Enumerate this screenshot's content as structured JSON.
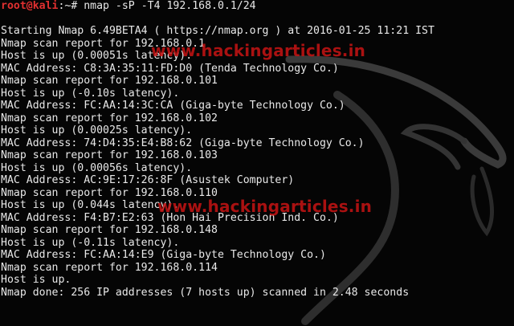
{
  "prompt": {
    "user_host": "root@kali",
    "sep": ":~# ",
    "command": "nmap -sP -T4 192.168.0.1/24"
  },
  "output": [
    "",
    "Starting Nmap 6.49BETA4 ( https://nmap.org ) at 2016-01-25 11:21 IST",
    "Nmap scan report for 192.168.0.1",
    "Host is up (0.00051s latency).",
    "MAC Address: C8:3A:35:11:FD:D0 (Tenda Technology Co.)",
    "Nmap scan report for 192.168.0.101",
    "Host is up (-0.10s latency).",
    "MAC Address: FC:AA:14:3C:CA (Giga-byte Technology Co.)",
    "Nmap scan report for 192.168.0.102",
    "Host is up (0.00025s latency).",
    "MAC Address: 74:D4:35:E4:B8:62 (Giga-byte Technology Co.)",
    "Nmap scan report for 192.168.0.103",
    "Host is up (0.00056s latency).",
    "MAC Address: AC:9E:17:26:8F (Asustek Computer)",
    "Nmap scan report for 192.168.0.110",
    "Host is up (0.044s latency).",
    "MAC Address: F4:B7:E2:63 (Hon Hai Precision Ind. Co.)",
    "Nmap scan report for 192.168.0.148",
    "Host is up (-0.11s latency).",
    "MAC Address: FC:AA:14:E9 (Giga-byte Technology Co.)",
    "Nmap scan report for 192.168.0.114",
    "Host is up.",
    "Nmap done: 256 IP addresses (7 hosts up) scanned in 2.48 seconds"
  ],
  "watermarks": {
    "top": "www.hackingarticles.in",
    "bottom": "www.hackingarticles.in"
  },
  "colors": {
    "background": "#050505",
    "text": "#e8e8e8",
    "prompt": "#e03030",
    "watermark": "#c81414"
  },
  "background_icon": "kali-dragon-icon"
}
